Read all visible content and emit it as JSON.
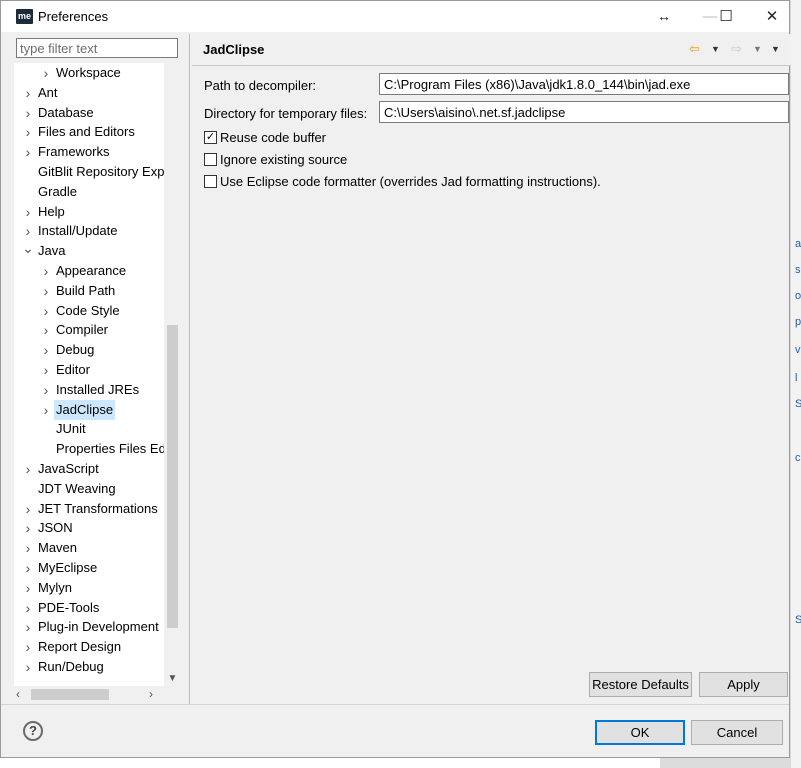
{
  "window": {
    "title": "Preferences",
    "app_icon_text": "me"
  },
  "filter": {
    "placeholder": "type filter text"
  },
  "tree": {
    "items": [
      {
        "label": "Workspace",
        "level": 1,
        "twisty": "collapsed"
      },
      {
        "label": "Ant",
        "level": 0,
        "twisty": "collapsed"
      },
      {
        "label": "Database",
        "level": 0,
        "twisty": "collapsed"
      },
      {
        "label": "Files and Editors",
        "level": 0,
        "twisty": "collapsed"
      },
      {
        "label": "Frameworks",
        "level": 0,
        "twisty": "collapsed"
      },
      {
        "label": "GitBlit Repository Exp",
        "level": 0,
        "twisty": "none"
      },
      {
        "label": "Gradle",
        "level": 0,
        "twisty": "none"
      },
      {
        "label": "Help",
        "level": 0,
        "twisty": "collapsed"
      },
      {
        "label": "Install/Update",
        "level": 0,
        "twisty": "collapsed"
      },
      {
        "label": "Java",
        "level": 0,
        "twisty": "expanded"
      },
      {
        "label": "Appearance",
        "level": 1,
        "twisty": "collapsed"
      },
      {
        "label": "Build Path",
        "level": 1,
        "twisty": "collapsed"
      },
      {
        "label": "Code Style",
        "level": 1,
        "twisty": "collapsed"
      },
      {
        "label": "Compiler",
        "level": 1,
        "twisty": "collapsed"
      },
      {
        "label": "Debug",
        "level": 1,
        "twisty": "collapsed"
      },
      {
        "label": "Editor",
        "level": 1,
        "twisty": "collapsed"
      },
      {
        "label": "Installed JREs",
        "level": 1,
        "twisty": "collapsed"
      },
      {
        "label": "JadClipse",
        "level": 1,
        "twisty": "collapsed",
        "selected": true
      },
      {
        "label": "JUnit",
        "level": 1,
        "twisty": "none"
      },
      {
        "label": "Properties Files Ed",
        "level": 1,
        "twisty": "none"
      },
      {
        "label": "JavaScript",
        "level": 0,
        "twisty": "collapsed"
      },
      {
        "label": "JDT Weaving",
        "level": 0,
        "twisty": "none"
      },
      {
        "label": "JET Transformations",
        "level": 0,
        "twisty": "collapsed"
      },
      {
        "label": "JSON",
        "level": 0,
        "twisty": "collapsed"
      },
      {
        "label": "Maven",
        "level": 0,
        "twisty": "collapsed"
      },
      {
        "label": "MyEclipse",
        "level": 0,
        "twisty": "collapsed"
      },
      {
        "label": "Mylyn",
        "level": 0,
        "twisty": "collapsed"
      },
      {
        "label": "PDE-Tools",
        "level": 0,
        "twisty": "collapsed"
      },
      {
        "label": "Plug-in Development",
        "level": 0,
        "twisty": "collapsed"
      },
      {
        "label": "Report Design",
        "level": 0,
        "twisty": "collapsed"
      },
      {
        "label": "Run/Debug",
        "level": 0,
        "twisty": "collapsed"
      }
    ]
  },
  "page": {
    "title": "JadClipse",
    "path_label": "Path to decompiler:",
    "path_value": "C:\\Program Files (x86)\\Java\\jdk1.8.0_144\\bin\\jad.exe",
    "dir_label": "Directory for temporary files:",
    "dir_value": "C:\\Users\\aisino\\.net.sf.jadclipse",
    "checks": [
      {
        "label": "Reuse code buffer",
        "checked": true
      },
      {
        "label": "Ignore existing source",
        "checked": false
      },
      {
        "label": "Use Eclipse code formatter (overrides Jad formatting instructions).",
        "checked": false
      }
    ],
    "restore_defaults_label": "Restore Defaults",
    "apply_label": "Apply"
  },
  "footer": {
    "ok_label": "OK",
    "cancel_label": "Cancel"
  },
  "icons": {
    "back": "back-arrow-icon",
    "forward": "forward-arrow-icon",
    "help": "help-icon"
  }
}
